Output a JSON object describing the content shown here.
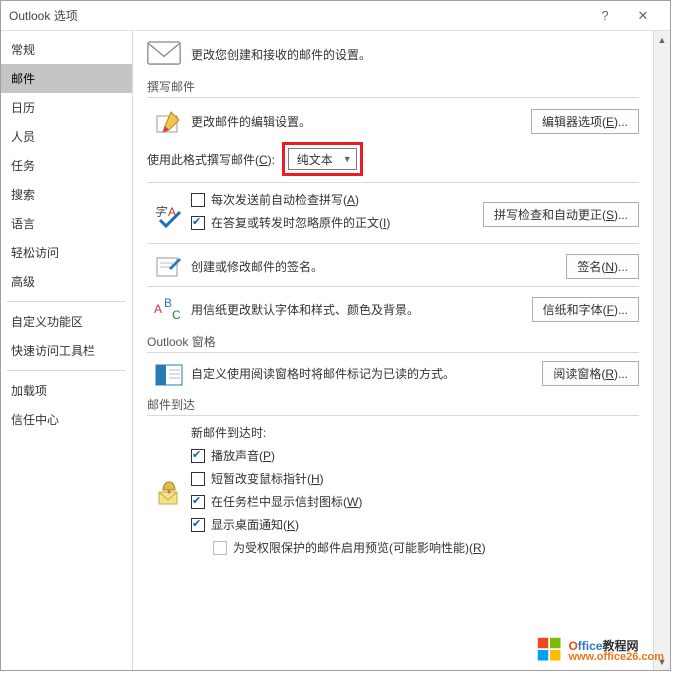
{
  "titlebar": {
    "title": "Outlook 选项",
    "help": "?",
    "close": "✕"
  },
  "sidebar": {
    "items": [
      "常规",
      "邮件",
      "日历",
      "人员",
      "任务",
      "搜索",
      "语言",
      "轻松访问",
      "高级"
    ],
    "items2": [
      "自定义功能区",
      "快速访问工具栏"
    ],
    "items3": [
      "加载项",
      "信任中心"
    ],
    "selected": "邮件"
  },
  "header": {
    "text": "更改您创建和接收的邮件的设置。"
  },
  "groups": {
    "compose": {
      "label": "撰写邮件",
      "line1": "更改邮件的编辑设置。",
      "btn_editor": "编辑器选项(",
      "btn_editor_u": "E",
      "btn_editor_end": ")...",
      "format_label": "使用此格式撰写邮件(",
      "format_u": "C",
      "format_end": "):",
      "format_value": "纯文本",
      "chk_spell": "每次发送前自动检查拼写(",
      "chk_spell_u": "A",
      "chk_spell_end": ")",
      "btn_spell": "拼写检查和自动更正(",
      "btn_spell_u": "S",
      "btn_spell_end": ")...",
      "chk_ignore": "在答复或转发时忽略原件的正文(",
      "chk_ignore_u": "I",
      "chk_ignore_end": ")",
      "sig_text": "创建或修改邮件的签名。",
      "btn_sig": "签名(",
      "btn_sig_u": "N",
      "btn_sig_end": ")...",
      "stat_text": "用信纸更改默认字体和样式、颜色及背景。",
      "btn_stat": "信纸和字体(",
      "btn_stat_u": "F",
      "btn_stat_end": ")..."
    },
    "pane": {
      "label": "Outlook 窗格",
      "text": "自定义使用阅读窗格时将邮件标记为已读的方式。",
      "btn": "阅读窗格(",
      "btn_u": "R",
      "btn_end": ")..."
    },
    "arrive": {
      "label": "邮件到达",
      "head": "新邮件到达时:",
      "c1": "播放声音(",
      "c1u": "P",
      "c1e": ")",
      "c2": "短暂改变鼠标指针(",
      "c2u": "H",
      "c2e": ")",
      "c3": "在任务栏中显示信封图标(",
      "c3u": "W",
      "c3e": ")",
      "c4": "显示桌面通知(",
      "c4u": "K",
      "c4e": ")",
      "c5": "为受权限保护的邮件启用预览(可能影响性能)(",
      "c5u": "R",
      "c5e": ")"
    }
  },
  "watermark": {
    "brand1a": "O",
    "brand1b": "ffice",
    "brand2": "教程网",
    "url": "www.office26.com"
  }
}
